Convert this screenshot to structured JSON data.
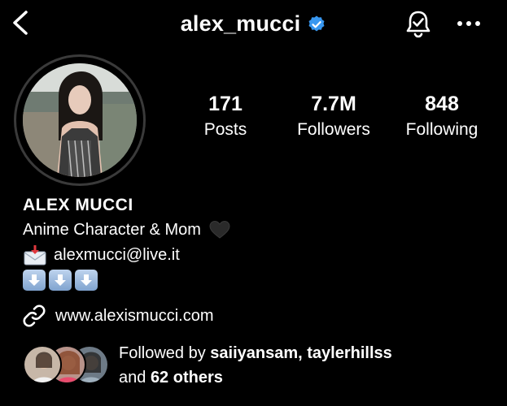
{
  "header": {
    "username": "alex_mucci",
    "verified": true,
    "icons": [
      "back-chevron-icon",
      "verified-badge-icon",
      "notification-bell-icon",
      "more-icon"
    ]
  },
  "stats": [
    {
      "value": "171",
      "label": "Posts"
    },
    {
      "value": "7.7M",
      "label": "Followers"
    },
    {
      "value": "848",
      "label": "Following"
    }
  ],
  "profile": {
    "display_name": "ALEX MUCCI",
    "bio_line_1": "Anime Character & Mom",
    "email": "alexmucci@live.it",
    "website": "www.alexismucci.com"
  },
  "followed_by": {
    "prefix": "Followed by ",
    "names": "saiiyansam, taylerhillss",
    "line2_prefix": "and ",
    "others": "62 others"
  },
  "colors": {
    "background": "#000000",
    "text": "#ffffff",
    "verified_blue": "#3897f0",
    "ring": "#3a3a3a"
  }
}
